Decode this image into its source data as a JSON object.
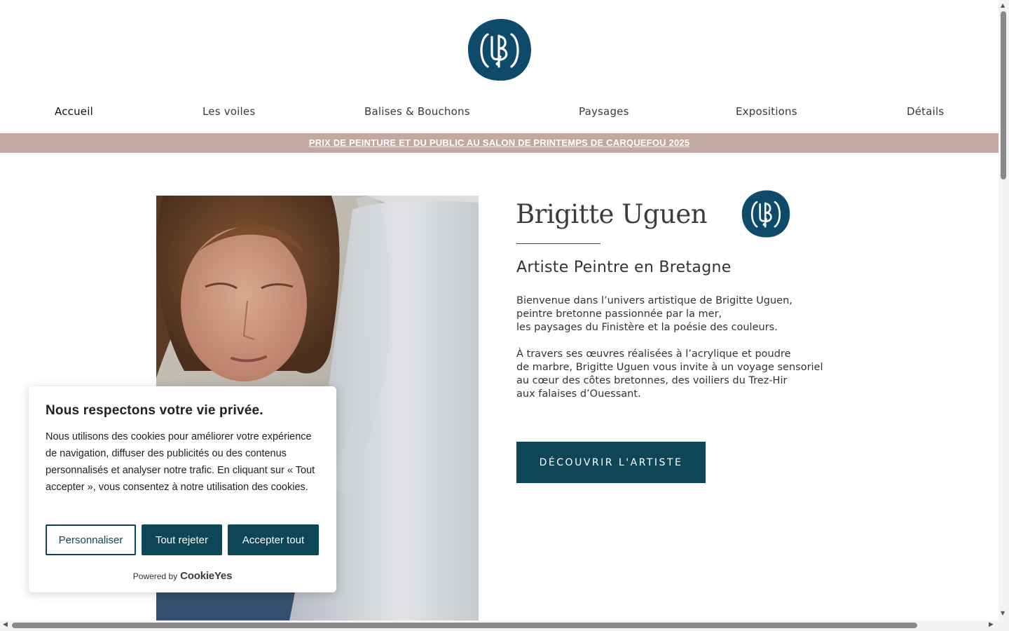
{
  "header": {
    "logo_alt": "UB",
    "nav": [
      {
        "label": "Accueil",
        "active": true
      },
      {
        "label": "Les voiles"
      },
      {
        "label": "Balises & Bouchons"
      },
      {
        "label": "Paysages"
      },
      {
        "label": "Expositions"
      },
      {
        "label": "Détails"
      }
    ]
  },
  "announcement": {
    "text": "PRIX DE PEINTURE ET DU PUBLIC AU SALON DE PRINTEMPS DE CARQUEFOU 2025"
  },
  "hero": {
    "title": "Brigitte Uguen",
    "subtitle": "Artiste Peintre en Bretagne",
    "paragraph_1": "Bienvenue dans l’univers artistique de Brigitte Uguen,\npeintre bretonne passionnée par la mer,\nles paysages du Finistère et la poésie des couleurs.",
    "paragraph_2": "À travers ses œuvres réalisées à l’acrylique et poudre\nde marbre, Brigitte Uguen vous invite à un voyage sensoriel\nau cœur des côtes bretonnes, des voiliers du Trez-Hir\naux falaises d’Ouessant.",
    "cta_label": "DÉCOUVRIR L'ARTISTE"
  },
  "cookie_banner": {
    "title": "Nous respectons votre vie privée.",
    "body": "Nous utilisons des cookies pour améliorer votre expérience de navigation, diffuser des publicités ou des contenus personnalisés et analyser notre trafic. En cliquant sur « Tout accepter », vous consentez à notre utilisation des cookies.",
    "btn_customize": "Personnaliser",
    "btn_reject": "Tout rejeter",
    "btn_accept": "Accepter tout",
    "powered_by": "Powered by",
    "powered_brand": "CookieYes"
  },
  "colors": {
    "brand_teal": "#0e4557",
    "announcement_bg": "#c3a8a0"
  }
}
